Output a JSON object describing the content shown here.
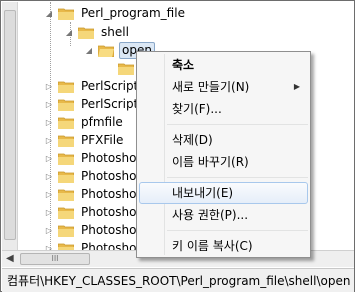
{
  "tree": {
    "nodes": [
      {
        "label": "Perl_program_file",
        "expander": "◢"
      },
      {
        "label": "shell",
        "expander": "◢"
      },
      {
        "label": "open",
        "expander": "◢"
      },
      {
        "label": "",
        "expander": ""
      },
      {
        "label": "PerlScript",
        "expander": "▷"
      },
      {
        "label": "PerlScriptF",
        "expander": "▷"
      },
      {
        "label": "pfmfile",
        "expander": "▷"
      },
      {
        "label": "PFXFile",
        "expander": "▷"
      },
      {
        "label": "Photoshop",
        "expander": "▷"
      },
      {
        "label": "Photoshop",
        "expander": "▷"
      },
      {
        "label": "Photoshop",
        "expander": "▷"
      },
      {
        "label": "Photoshop",
        "expander": "▷"
      },
      {
        "label": "Photoshop",
        "expander": "▷"
      },
      {
        "label": "Photoshop",
        "expander": "▷"
      }
    ]
  },
  "context_menu": {
    "items": [
      {
        "label": "축소"
      },
      {
        "label": "새로 만들기(N)",
        "submenu": "▶"
      },
      {
        "label": "찾기(F)..."
      },
      {
        "label": "삭제(D)"
      },
      {
        "label": "이름 바꾸기(R)"
      },
      {
        "label": "내보내기(E)"
      },
      {
        "label": "사용 권한(P)..."
      },
      {
        "label": "키 이름 복사(C)"
      }
    ]
  },
  "hscroll": {
    "left_arrow": "◀",
    "thumb_grip": "III"
  },
  "status_bar": {
    "path": "컴퓨터\\HKEY_CLASSES_ROOT\\Perl_program_file\\shell\\open"
  },
  "colors": {
    "folder": "#e8b94a",
    "selection": "#dbe7f4",
    "menu_hover_border": "#a8c8ec"
  }
}
